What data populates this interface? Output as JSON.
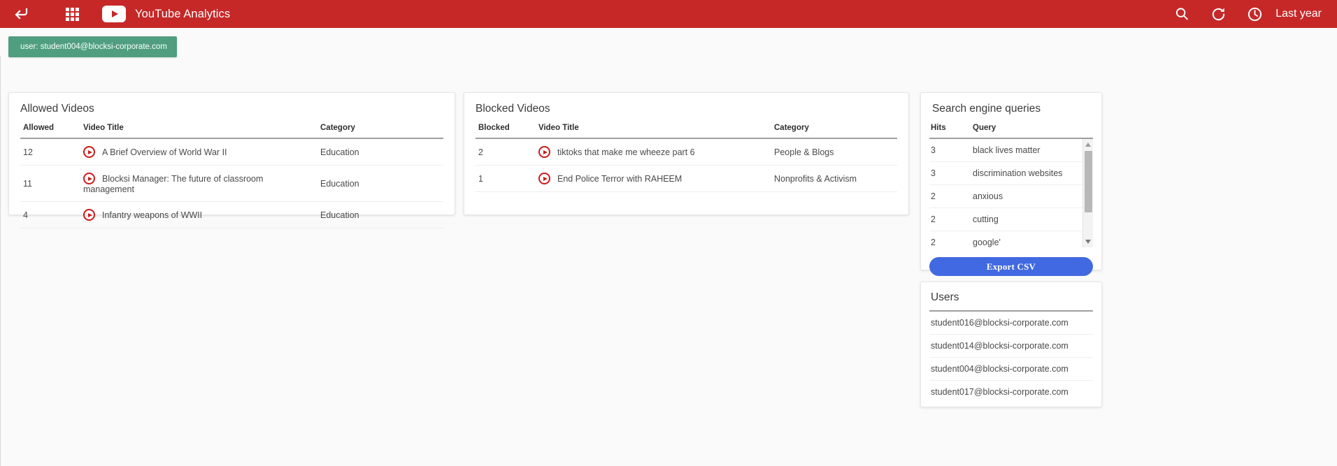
{
  "header": {
    "back_icon": "back-arrow-icon",
    "apps_icon": "app-grid-icon",
    "logo_icon": "youtube-logo-icon",
    "title": "YouTube Analytics",
    "search_icon": "search-icon",
    "refresh_icon": "refresh-icon",
    "clock_icon": "clock-icon",
    "period_label": "Last year"
  },
  "user_chip": {
    "label": "user: student004@blocksi-corporate.com",
    "color": "#4f9e7f"
  },
  "allowed_videos": {
    "title": "Allowed Videos",
    "columns": [
      "Allowed",
      "Video Title",
      "Category"
    ],
    "rows": [
      {
        "count": "12",
        "title": "A Brief Overview of World War II",
        "category": "Education"
      },
      {
        "count": "11",
        "title": "Blocksi Manager: The future of classroom management",
        "category": "Education"
      },
      {
        "count": "4",
        "title": "Infantry weapons of WWII",
        "category": "Education"
      }
    ]
  },
  "blocked_videos": {
    "title": "Blocked Videos",
    "columns": [
      "Blocked",
      "Video Title",
      "Category"
    ],
    "rows": [
      {
        "count": "2",
        "title": "tiktoks that make me wheeze part 6",
        "category": "People & Blogs"
      },
      {
        "count": "1",
        "title": "End Police Terror with RAHEEM",
        "category": "Nonprofits & Activism"
      }
    ]
  },
  "search_queries": {
    "title": "Search engine queries",
    "columns": [
      "Hits",
      "Query"
    ],
    "rows": [
      {
        "hits": "3",
        "query": "black lives matter"
      },
      {
        "hits": "3",
        "query": "discrimination websites"
      },
      {
        "hits": "2",
        "query": "anxious"
      },
      {
        "hits": "2",
        "query": "cutting"
      },
      {
        "hits": "2",
        "query": "google'"
      }
    ],
    "export_label": "Export CSV",
    "export_color": "#4169e1"
  },
  "users": {
    "title": "Users",
    "items": [
      "student016@blocksi-corporate.com",
      "student014@blocksi-corporate.com",
      "student004@blocksi-corporate.com",
      "student017@blocksi-corporate.com"
    ]
  },
  "colors": {
    "brand_red": "#c62828",
    "play_icon_red": "#cc1b1b",
    "page_bg": "#fafafa"
  }
}
